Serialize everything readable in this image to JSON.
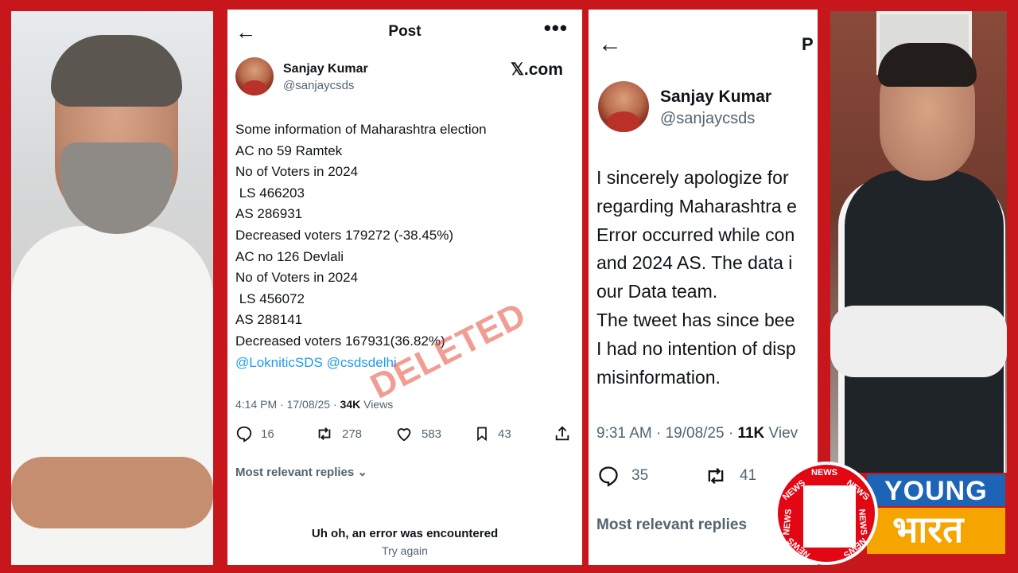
{
  "tweet1": {
    "header_title": "Post",
    "more_label": "•••",
    "user_name": "Sanjay Kumar",
    "user_handle": "@sanjaycsds",
    "site_label": "𝕏.com",
    "lines": [
      "Some information of Maharashtra election",
      "AC no 59 Ramtek",
      "No of Voters in 2024",
      " LS 466203",
      "AS 286931",
      "Decreased voters 179272 (-38.45%)",
      "AC no 126 Devlali",
      "No of Voters in 2024",
      " LS 456072",
      "AS 288141",
      "Decreased voters 167931(36.82%)"
    ],
    "mentions": "@LokniticSDS @csdsdelhi",
    "time": "4:14 PM · 17/08/25 · ",
    "views_count": "34K",
    "views_label": " Views",
    "stamp": "DELETED",
    "replies": "16",
    "reposts": "278",
    "likes": "583",
    "bookmarks": "43",
    "relevant_label": "Most relevant replies ⌄",
    "error_title": "Uh oh, an error was encountered",
    "error_retry": "Try again"
  },
  "tweet2": {
    "header_title": "P",
    "user_name": "Sanjay Kumar",
    "user_handle": "@sanjaycsds",
    "lines": [
      "I sincerely apologize for",
      "regarding Maharashtra e",
      "Error occurred while con",
      "and 2024 AS. The data i",
      "our Data team.",
      "The tweet has since bee",
      "I had no intention of disp",
      "misinformation."
    ],
    "time": "9:31 AM · 19/08/25 · ",
    "views_count": "11K",
    "views_label": " Viev",
    "replies": "35",
    "reposts": "41",
    "relevant_label": "Most relevant replies"
  },
  "logo": {
    "news_word": "NEWS",
    "young": "YOUNG",
    "bharat": "भारत"
  },
  "colors": {
    "frame_red": "#c8161d",
    "mention_blue": "#1d9bf0",
    "stamp_red": "#e74c3c",
    "logo_blue": "#1d63b6",
    "logo_orange": "#f5a400"
  }
}
